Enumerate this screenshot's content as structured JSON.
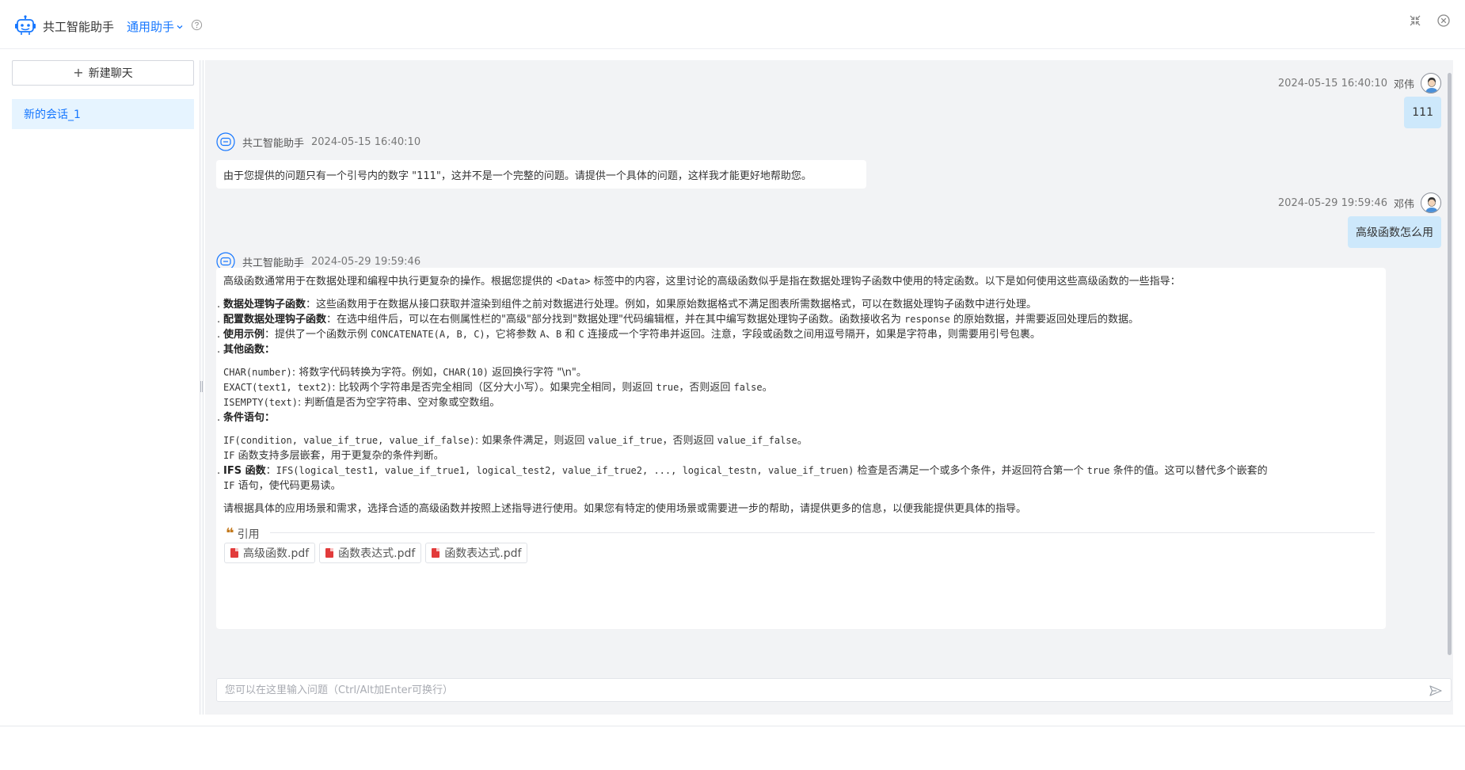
{
  "header": {
    "app_title": "共工智能助手",
    "mode_label": "通用助手",
    "icons": [
      "robot-logo-icon",
      "chevron-down-icon",
      "question-circle-icon",
      "compress-icon",
      "close-circle-icon"
    ]
  },
  "sidebar": {
    "new_chat_label": "新建聊天",
    "sessions": [
      {
        "label": "新的会话_1",
        "active": true
      }
    ]
  },
  "colors": {
    "accent": "#1677ff",
    "active_bg": "#e6f4ff",
    "user_bubble": "#cde8fb",
    "chat_bg": "#f2f3f5",
    "pdf_red": "#e23b3b"
  },
  "messages": [
    {
      "role": "user",
      "time": "2024-05-15 16:40:10",
      "name": "邓伟",
      "text": "111"
    },
    {
      "role": "assistant",
      "name": "共工智能助手",
      "time": "2024-05-15 16:40:10",
      "text": "由于您提供的问题只有一个引号内的数字 \"111\"，这并不是一个完整的问题。请提供一个具体的问题，这样我才能更好地帮助您。"
    },
    {
      "role": "user",
      "time": "2024-05-29 19:59:46",
      "name": "邓伟",
      "text": "高级函数怎么用"
    },
    {
      "role": "assistant",
      "name": "共工智能助手",
      "time": "2024-05-29 19:59:46",
      "answer": {
        "intro_a": "高级函数通常用于在数据处理和编程中执行更复杂的操作。根据您提供的 ",
        "intro_code": "<Data>",
        "intro_b": " 标签中的内容，这里讨论的高级函数似乎是指在数据处理钩子函数中使用的特定函数。以下是如何使用这些高级函数的一些指导：",
        "item1_title": "数据处理钩子函数",
        "item1_text": "：这些函数用于在数据从接口获取并渲染到组件之前对数据进行处理。例如，如果原始数据格式不满足图表所需数据格式，可以在数据处理钩子函数中进行处理。",
        "item2_title": "配置数据处理钩子函数",
        "item2_text_a": "：在选中组件后，可以在右侧属性栏的\"高级\"部分找到\"数据处理\"代码编辑框，并在其中编写数据处理钩子函数。函数接收名为 ",
        "item2_code": "response",
        "item2_text_b": " 的原始数据，并需要返回处理后的数据。",
        "item3_title": "使用示例",
        "item3_text_a": "：提供了一个函数示例 ",
        "item3_code1": "CONCATENATE(A, B, C)",
        "item3_text_b": "，它将参数 ",
        "item3_code2": "A",
        "item3_text_c": "、",
        "item3_code3": "B",
        "item3_text_d": " 和 ",
        "item3_code4": "C",
        "item3_text_e": " 连接成一个字符串并返回。注意，字段或函数之间用逗号隔开，如果是字符串，则需要用引号包裹。",
        "item4_title": "其他函数",
        "item4_colon": "：",
        "char_code": "CHAR(number)",
        "char_text_a": ": 将数字代码转换为字符。例如，",
        "char_code2": "CHAR(10)",
        "char_text_b": " 返回换行字符 \"\\n\"。",
        "exact_code": "EXACT(text1, text2)",
        "exact_text_a": ": 比较两个字符串是否完全相同（区分大小写）。如果完全相同，则返回 ",
        "exact_code2": "true",
        "exact_text_b": "，否则返回 ",
        "exact_code3": "false",
        "exact_text_c": "。",
        "isempty_code": "ISEMPTY(text)",
        "isempty_text": ": 判断值是否为空字符串、空对象或空数组。",
        "item5_title": "条件语句",
        "item5_colon": "：",
        "if_code": "IF(condition, value_if_true, value_if_false)",
        "if_text_a": ": 如果条件满足，则返回 ",
        "if_code2": "value_if_true",
        "if_text_b": "，否则返回 ",
        "if_code3": "value_if_false",
        "if_text_c": "。",
        "if_nested_code": "IF",
        "if_nested_text": " 函数支持多层嵌套，用于更复杂的条件判断。",
        "item6_title": "IFS 函数",
        "item6_colon": "：",
        "ifs_code": "IFS(logical_test1, value_if_true1, logical_test2, value_if_true2, ..., logical_testn, value_if_truen)",
        "ifs_text_a": " 检查是否满足一个或多个条件，并返回符合第一个 ",
        "ifs_code2": "true",
        "ifs_text_b": " 条件的值。这可以替代多个嵌套的",
        "ifs_code3": "IF",
        "ifs_text_c": " 语句，使代码更易读。",
        "closing": "请根据具体的应用场景和需求，选择合适的高级函数并按照上述指导进行使用。如果您有特定的使用场景或需要进一步的帮助，请提供更多的信息，以便我能提供更具体的指导。"
      },
      "references_label": "引用",
      "references": [
        {
          "label": "高级函数.pdf",
          "icon": "pdf-file-icon"
        },
        {
          "label": "函数表达式.pdf",
          "icon": "pdf-file-icon"
        },
        {
          "label": "函数表达式.pdf",
          "icon": "pdf-file-icon"
        }
      ]
    }
  ],
  "composer": {
    "placeholder": "您可以在这里输入问题（Ctrl/Alt加Enter可换行）",
    "send_icon": "send-icon"
  }
}
